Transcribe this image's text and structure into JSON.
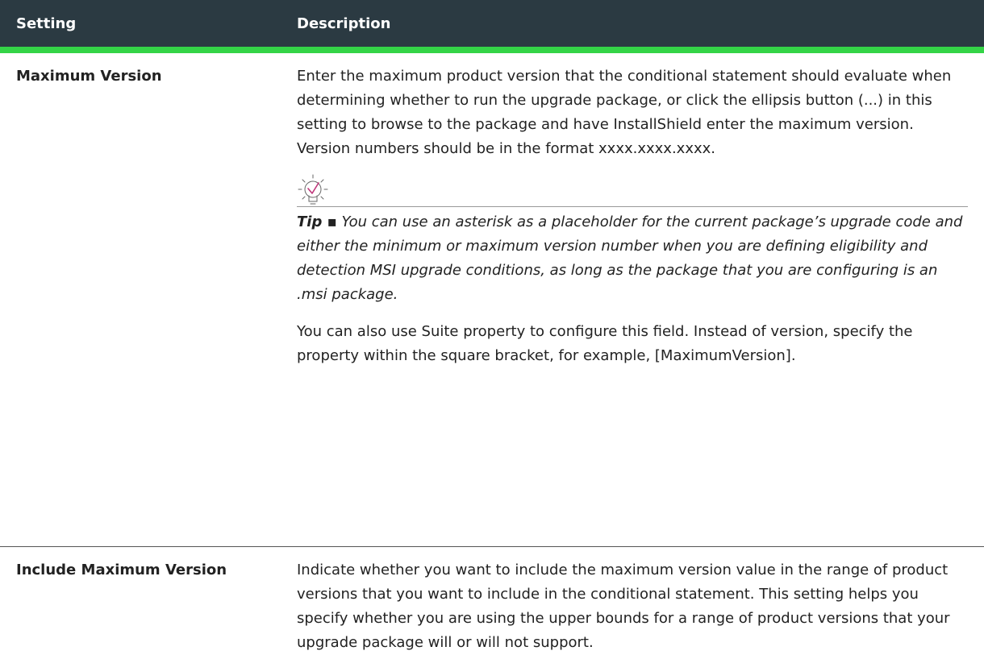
{
  "table": {
    "headers": {
      "setting": "Setting",
      "description": "Description"
    },
    "rows": [
      {
        "setting": "Maximum Version",
        "description": "Enter the maximum product version that the conditional statement should evaluate when determining whether to run the upgrade package, or click the ellipsis button (...) in this setting to browse to the package and have InstallShield enter the maximum version. Version numbers should be in the format xxxx.xxxx.xxxx.",
        "tip_label": "Tip ▪",
        "tip_text": "You can use an asterisk as a placeholder for the current package’s upgrade code and either the minimum or maximum version number when you are defining eligibility and detection MSI upgrade conditions, as long as the package that you are configuring is an .msi package.",
        "extra": "You can also use Suite property to configure this field. Instead of version, specify the property within the square bracket, for example, [MaximumVersion]."
      },
      {
        "setting": "Include Maximum Version",
        "description": "Indicate whether you want to include the maximum version value in the range of product versions that you want to include in the conditional statement. This setting helps you specify whether you are using the upper bounds for a range of product versions that your upgrade package will or will not support."
      }
    ]
  },
  "icons": {
    "tip": "lightbulb-check-icon"
  },
  "colors": {
    "header_bg": "#2b3a42",
    "header_accent": "#34d447",
    "icon_accent": "#c0367a"
  }
}
